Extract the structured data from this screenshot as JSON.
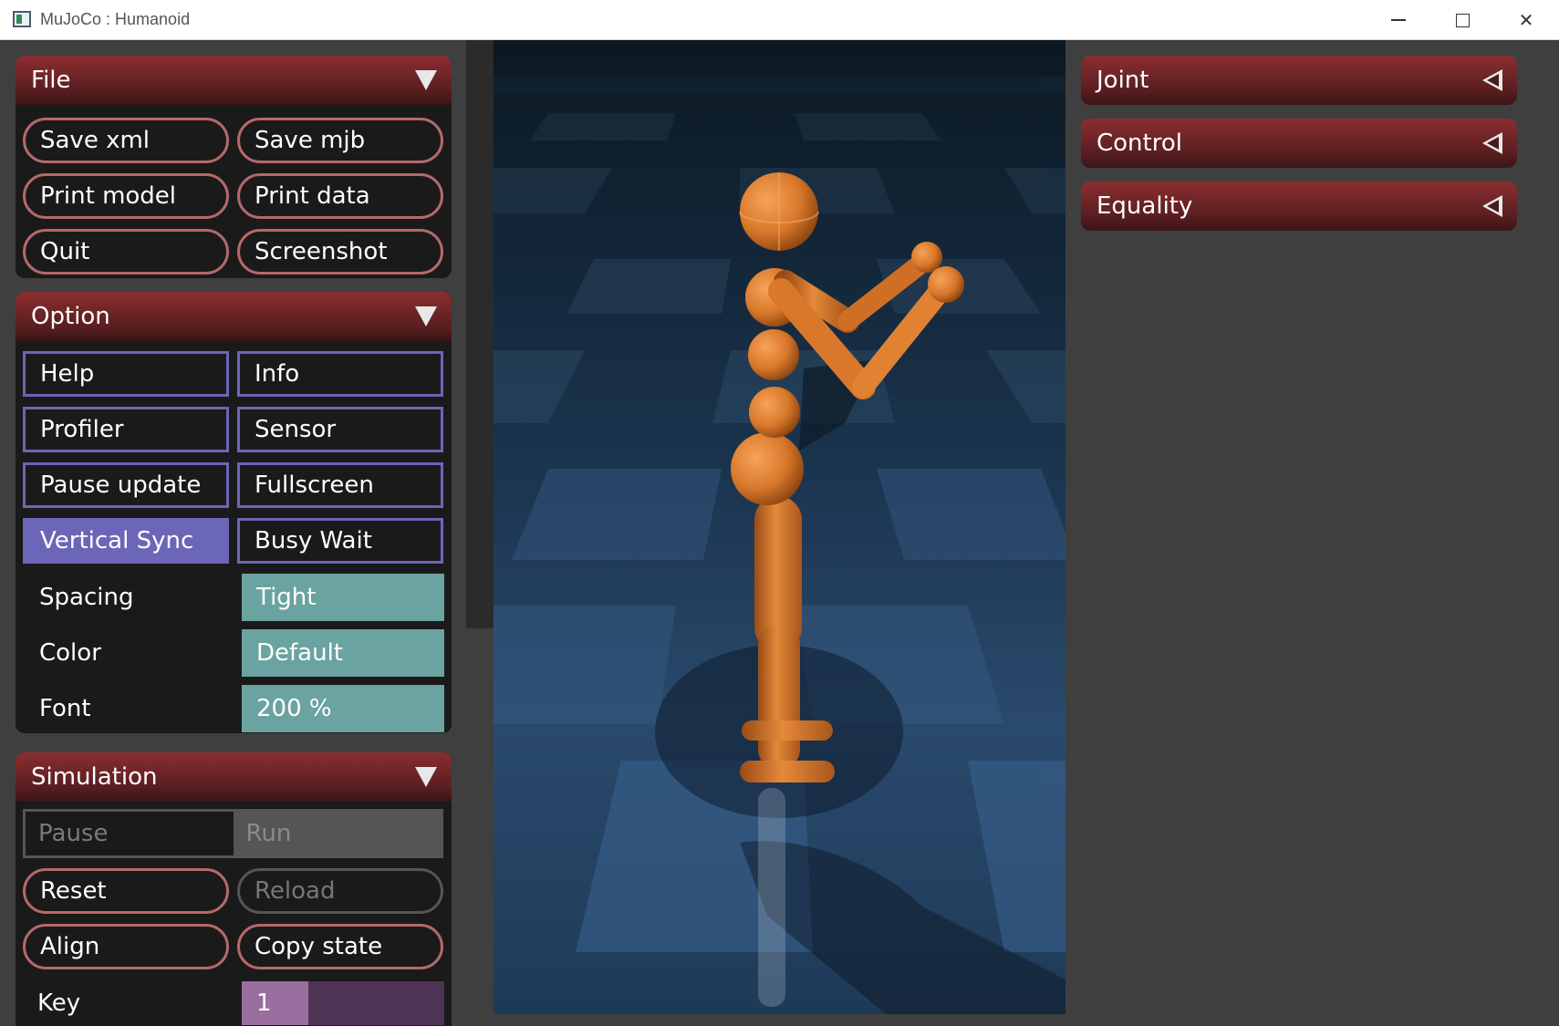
{
  "window": {
    "title": "MuJoCo : Humanoid"
  },
  "file": {
    "header": "File",
    "buttons": [
      "Save xml",
      "Save mjb",
      "Print model",
      "Print data",
      "Quit",
      "Screenshot"
    ]
  },
  "option": {
    "header": "Option",
    "checks": [
      {
        "label": "Help",
        "on": false
      },
      {
        "label": "Info",
        "on": false
      },
      {
        "label": "Profiler",
        "on": false
      },
      {
        "label": "Sensor",
        "on": false
      },
      {
        "label": "Pause update",
        "on": false
      },
      {
        "label": "Fullscreen",
        "on": false
      },
      {
        "label": "Vertical Sync",
        "on": true
      },
      {
        "label": "Busy Wait",
        "on": false
      }
    ],
    "spacing": {
      "label": "Spacing",
      "value": "Tight"
    },
    "color": {
      "label": "Color",
      "value": "Default"
    },
    "font": {
      "label": "Font",
      "value": "200 %"
    }
  },
  "simulation": {
    "header": "Simulation",
    "run_mode": {
      "options": [
        "Pause",
        "Run"
      ],
      "selected": "Run"
    },
    "reset": "Reset",
    "reload": "Reload",
    "align": "Align",
    "copy_state": "Copy state",
    "key": {
      "label": "Key",
      "value": "1",
      "fraction": 0.33
    }
  },
  "right": {
    "sections": [
      "Joint",
      "Control",
      "Equality"
    ]
  },
  "colors": {
    "section_header": "#8b2e30",
    "check_border": "#6b66b8",
    "select_bg": "#6aa39f",
    "humanoid": "#d9782a"
  }
}
